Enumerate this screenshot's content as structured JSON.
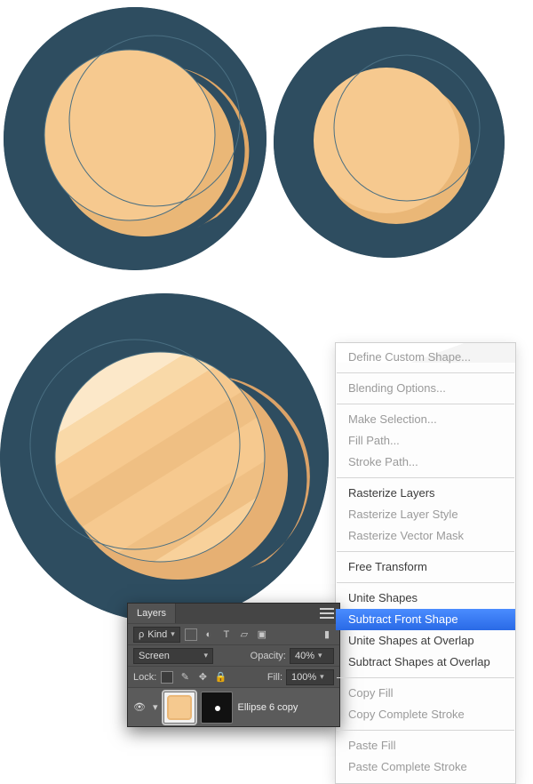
{
  "layers_panel": {
    "title": "Layers",
    "kind_label": "Kind",
    "blend_mode": "Screen",
    "opacity_label": "Opacity:",
    "opacity_value": "40%",
    "lock_label": "Lock:",
    "fill_label": "Fill:",
    "fill_value": "100%",
    "layer_name": "Ellipse 6 copy"
  },
  "context_menu": {
    "items": [
      {
        "label": "Define Custom Shape...",
        "enabled": false
      },
      {
        "sep": true
      },
      {
        "label": "Blending Options...",
        "enabled": false
      },
      {
        "sep": true
      },
      {
        "label": "Make Selection...",
        "enabled": false
      },
      {
        "label": "Fill Path...",
        "enabled": false
      },
      {
        "label": "Stroke Path...",
        "enabled": false
      },
      {
        "sep": true
      },
      {
        "label": "Rasterize Layers",
        "enabled": true
      },
      {
        "label": "Rasterize Layer Style",
        "enabled": false
      },
      {
        "label": "Rasterize Vector Mask",
        "enabled": false
      },
      {
        "sep": true
      },
      {
        "label": "Free Transform",
        "enabled": true
      },
      {
        "sep": true
      },
      {
        "label": "Unite Shapes",
        "enabled": true
      },
      {
        "label": "Subtract Front Shape",
        "enabled": true,
        "highlight": true
      },
      {
        "label": "Unite Shapes at Overlap",
        "enabled": true
      },
      {
        "label": "Subtract Shapes at Overlap",
        "enabled": true
      },
      {
        "sep": true
      },
      {
        "label": "Copy Fill",
        "enabled": false
      },
      {
        "label": "Copy Complete Stroke",
        "enabled": false
      },
      {
        "sep": true
      },
      {
        "label": "Paste Fill",
        "enabled": false
      },
      {
        "label": "Paste Complete Stroke",
        "enabled": false
      }
    ]
  }
}
